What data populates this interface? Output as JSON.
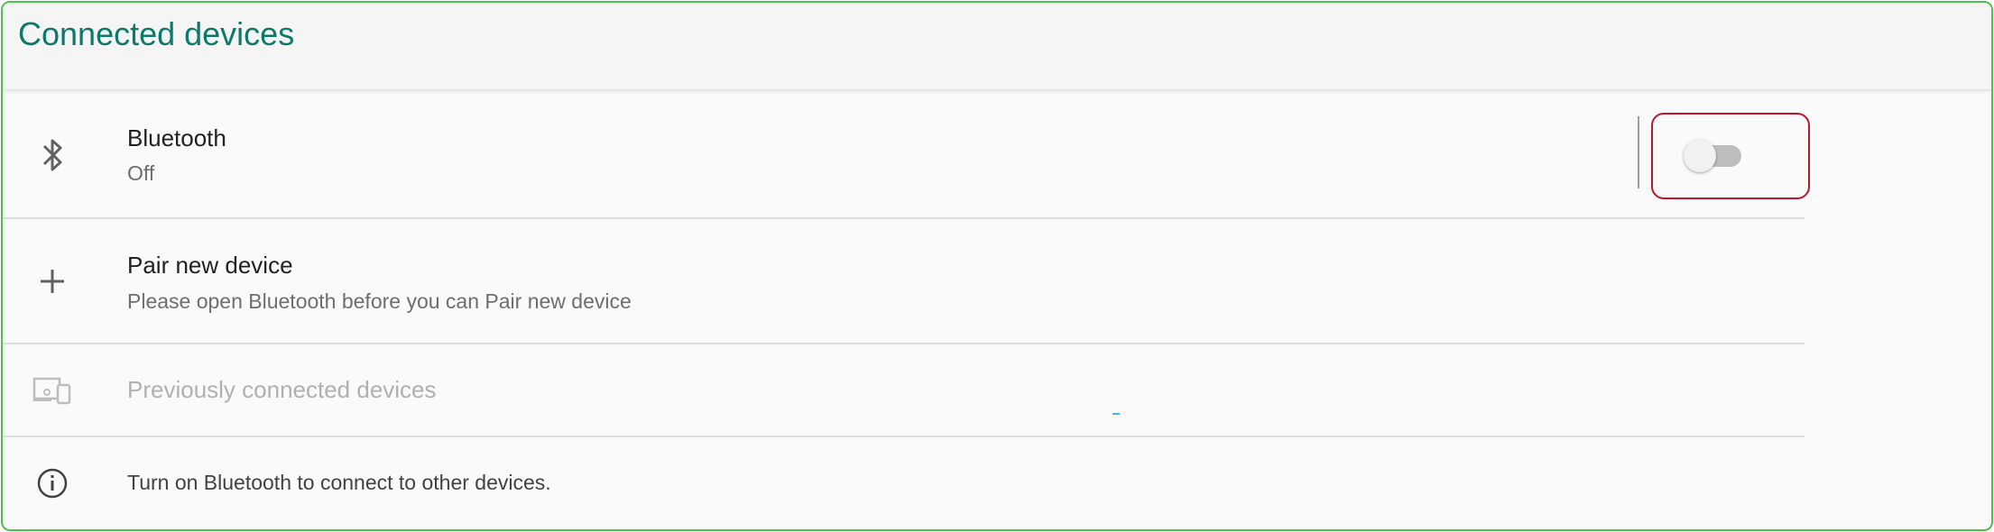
{
  "header": {
    "title": "Connected devices"
  },
  "bluetooth": {
    "icon": "bluetooth-icon",
    "title": "Bluetooth",
    "status": "Off",
    "toggle_on": false
  },
  "pair_new": {
    "icon": "plus-icon",
    "title": "Pair new device",
    "subtitle": "Please open Bluetooth before you can Pair new device"
  },
  "previous": {
    "icon": "devices-icon",
    "title": "Previously connected devices"
  },
  "info": {
    "icon": "info-icon",
    "text": "Turn on Bluetooth to connect to other devices."
  },
  "colors": {
    "accent": "#0b7a6a",
    "highlight": "#c0152a",
    "frame": "#4cc24c"
  }
}
